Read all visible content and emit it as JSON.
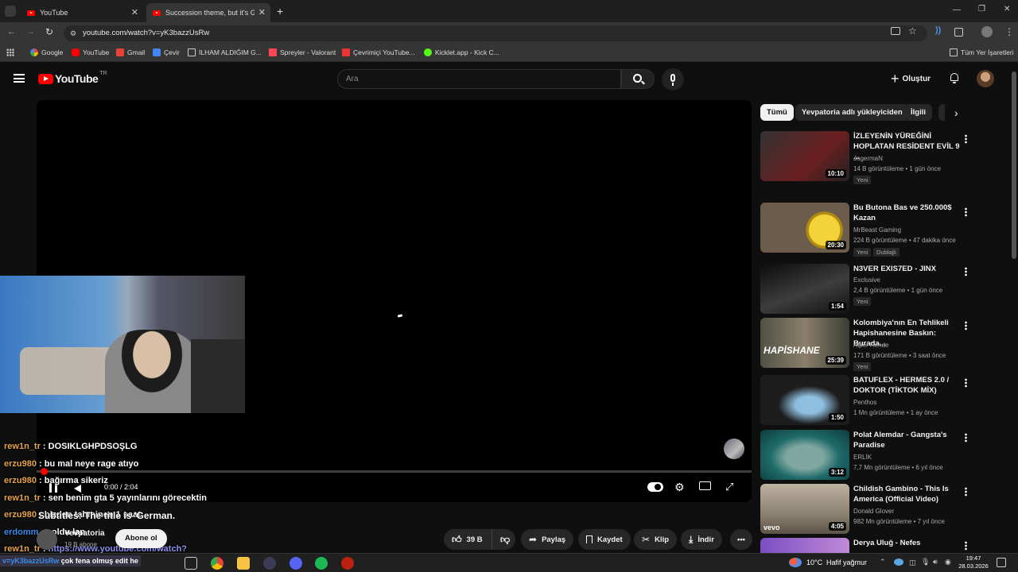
{
  "browser": {
    "tabs": [
      {
        "title": "YouTube"
      },
      {
        "title": "Succession theme, but it's Germ"
      }
    ],
    "url": "youtube.com/watch?v=yK3bazzUsRw",
    "bookmarks": [
      "Google",
      "YouTube",
      "Gmail",
      "Çevir",
      "İLHAM ALDIĞIM G...",
      "Spreyler - Valorant",
      "Çevrimiçi YouTube...",
      "Kicklet.app - Kick C..."
    ],
    "all_bookmarks": "Tüm Yer İşaretleri"
  },
  "youtube": {
    "logo": "YouTube",
    "region": "TR",
    "search_placeholder": "Ara",
    "create_label": "Oluştur",
    "chips": [
      "Tümü",
      "Yevpatoria adlı yükleyiciden",
      "İlgili"
    ],
    "player": {
      "time": "0:00 / 2:04",
      "caption": "Subtitles: The title is 'German.",
      "caption_overlap": "Succession theme, but it's"
    },
    "channel": {
      "name": "Yevpatoria",
      "subs": "19 B abone",
      "subscribe_label": "Abone ol"
    },
    "actions": {
      "likes": "39 B",
      "share": "Paylaş",
      "save": "Kaydet",
      "clip": "Klip",
      "download": "İndir"
    }
  },
  "chat": [
    {
      "user": "rew1n_tr",
      "msg": "DOSIKLGHPDSOŞLG"
    },
    {
      "user": "erzu980",
      "msg": "bu mal neye rage atıyo"
    },
    {
      "user": "erzu980",
      "msg": "bağırma sikeriz"
    },
    {
      "user": "rew1n_tr",
      "msg": "sen benim gta 5 yayınlarını görecektin"
    },
    {
      "user": "erzu980",
      "msg": "bizden tahminen 1 saat"
    },
    {
      "user": "erdomm",
      "msg": "noldu lan"
    },
    {
      "user": "rew1n_tr",
      "msg": "https://www.youtube.com/watch?"
    },
    {
      "user": "v=yK3bazzUsRw",
      "msg": "çok fena olmuş edit he"
    }
  ],
  "recommendations": [
    {
      "title": "İZLEYENİN YÜREĞİNİ HOPLATAN RESİDENT EVİL 9 ...",
      "channel": "JagermaN",
      "meta": "14 B görüntüleme • 1 gün önce",
      "duration": "10:10",
      "badge": "Yeni",
      "thumb_colors": [
        "#2a2a2a",
        "#6b1f1f"
      ]
    },
    {
      "title": "Bu Butona Bas ve 250.000$ Kazan",
      "channel": "MrBeast Gaming",
      "meta": "224 B görüntüleme • 47 dakika önce",
      "duration": "20:30",
      "badge": "Yeni",
      "badge2": "Dublajlı",
      "thumb_colors": [
        "#b89a70",
        "#d9b11a"
      ]
    },
    {
      "title": "N3VER EXIS7ED - JINX",
      "channel": "Exclusive",
      "meta": "2,4 B görüntüleme • 1 gün önce",
      "duration": "1:54",
      "badge": "Yeni",
      "thumb_colors": [
        "#111",
        "#4a4a4a"
      ]
    },
    {
      "title": "Kolombiya'nın En Tehlikeli Hapishanesine Baskın: Burada...",
      "channel": "Alper Rende",
      "meta": "171 B görüntüleme • 3 saat önce",
      "duration": "25:39",
      "badge": "Yeni",
      "thumb_colors": [
        "#5b5d50",
        "#8a7f6a"
      ]
    },
    {
      "title": "BATUFLEX - HERMES 2.0 / DOKTOR (TİKTOK MİX)",
      "channel": "Penthos",
      "meta": "1 Mn görüntüleme • 1 ay önce",
      "duration": "1:50",
      "thumb_colors": [
        "#0a0a0a",
        "#6fa0c8"
      ]
    },
    {
      "title": "Polat Alemdar - Gangsta's Paradise",
      "channel": "ERLİK",
      "meta": "7,7 Mn görüntüleme • 6 yıl önce",
      "duration": "3:12",
      "thumb_colors": [
        "#1a5a5a",
        "#6ab0a8"
      ]
    },
    {
      "title": "Childish Gambino - This Is America (Official Video)",
      "channel": "Donald Glover",
      "meta": "982 Mn görüntüleme • 7 yıl önce",
      "duration": "4:05",
      "thumb_colors": [
        "#a69a88",
        "#5b5346"
      ]
    },
    {
      "title": "Derya Uluğ - Nefes",
      "channel": "",
      "meta": "",
      "duration": "",
      "thumb_colors": [
        "#7a4fc2",
        "#c08ad8"
      ]
    }
  ],
  "taskbar": {
    "weather": "10°C",
    "weather_text": "Hafif yağmur",
    "time": "19:47",
    "date": "28.03.2026"
  }
}
